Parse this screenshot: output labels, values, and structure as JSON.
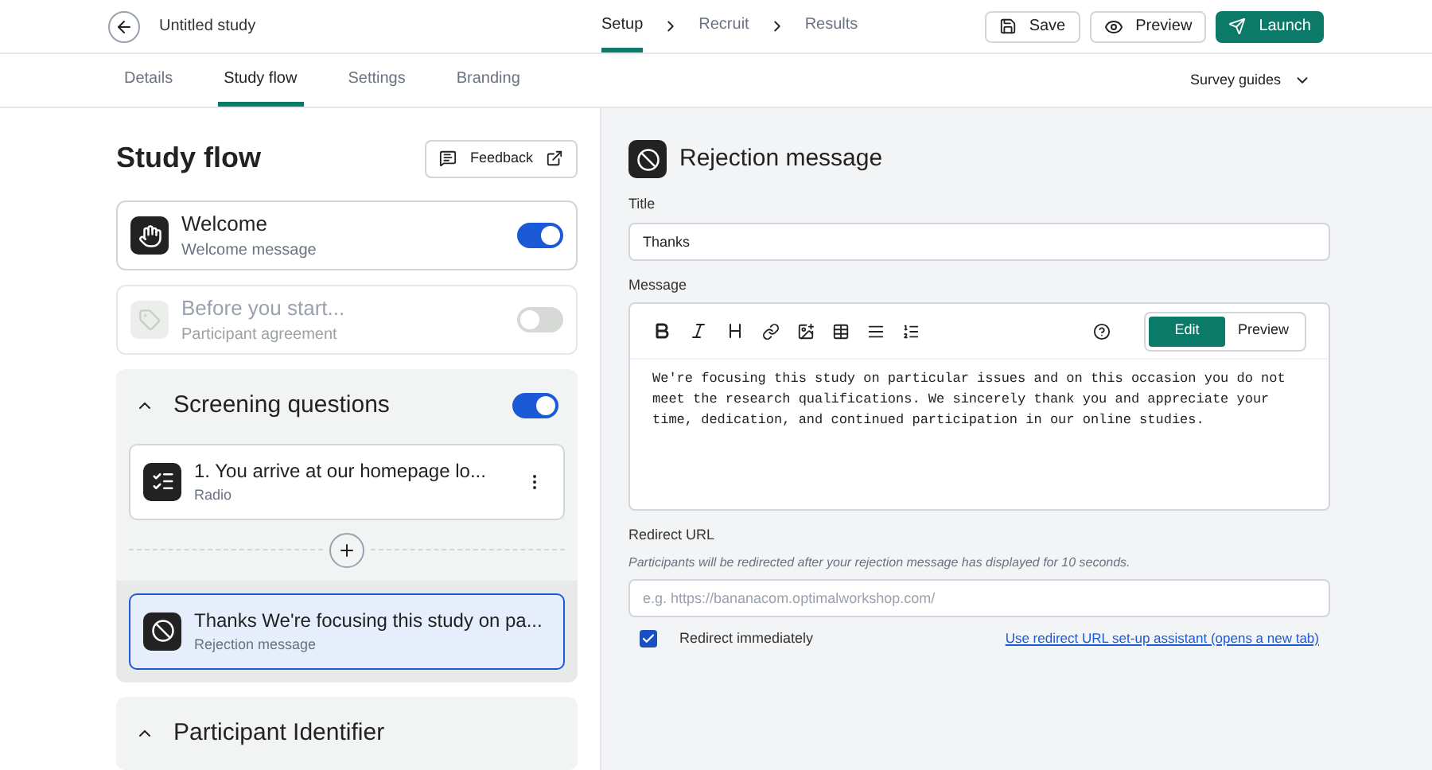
{
  "header": {
    "title": "Untitled study",
    "steps": [
      {
        "label": "Setup",
        "selected": true
      },
      {
        "label": "Recruit",
        "selected": false
      },
      {
        "label": "Results",
        "selected": false
      }
    ],
    "buttons": [
      {
        "kind": "save",
        "label": "Save"
      },
      {
        "kind": "preview",
        "label": "Preview"
      },
      {
        "kind": "launch",
        "label": "Launch"
      }
    ]
  },
  "tabs": [
    {
      "label": "Details",
      "selected": false
    },
    {
      "label": "Study flow",
      "selected": true
    },
    {
      "label": "Settings",
      "selected": false
    },
    {
      "label": "Branding",
      "selected": false
    }
  ],
  "guides": "Survey guides",
  "flow": {
    "title": "Study flow",
    "feedback": "Feedback",
    "items": [
      {
        "kind": "welcome",
        "title": "Welcome",
        "subtitle": "Welcome message",
        "on": true,
        "disabled": false
      },
      {
        "kind": "agreement",
        "title": "Before you start...",
        "subtitle": "Participant agreement",
        "on": false,
        "disabled": true
      },
      {
        "kind": "section",
        "title": "Screening questions",
        "expanded": true,
        "on": true,
        "children": [
          {
            "kind": "question",
            "title": "1. You arrive at our homepage lo...",
            "subtitle": "Radio",
            "selected": false
          },
          {
            "kind": "rejection",
            "title": "Thanks We're focusing this study on pa...",
            "subtitle": "Rejection message",
            "selected": true
          }
        ]
      },
      {
        "kind": "section",
        "title": "Participant Identifier",
        "expanded": true
      }
    ]
  },
  "editor": {
    "heading": "Rejection message",
    "title_label": "Title",
    "title_value": "Thanks",
    "message_label": "Message",
    "modes": [
      {
        "label": "Edit",
        "selected": true
      },
      {
        "label": "Preview",
        "selected": false
      }
    ],
    "message": "We're focusing this study on particular issues and on this occasion you do not meet the research qualifications. We sincerely thank you and appreciate your time, dedication, and continued participation in our online studies.",
    "redirect_label": "Redirect URL",
    "redirect_hint": "Participants will be redirected after your rejection message has displayed for 10 seconds.",
    "redirect_placeholder": "e.g. https://bananacom.optimalworkshop.com/",
    "immediately": {
      "label": "Redirect immediately",
      "checked": true
    },
    "assistant_link": "Use redirect URL set-up assistant (opens a new tab)"
  }
}
